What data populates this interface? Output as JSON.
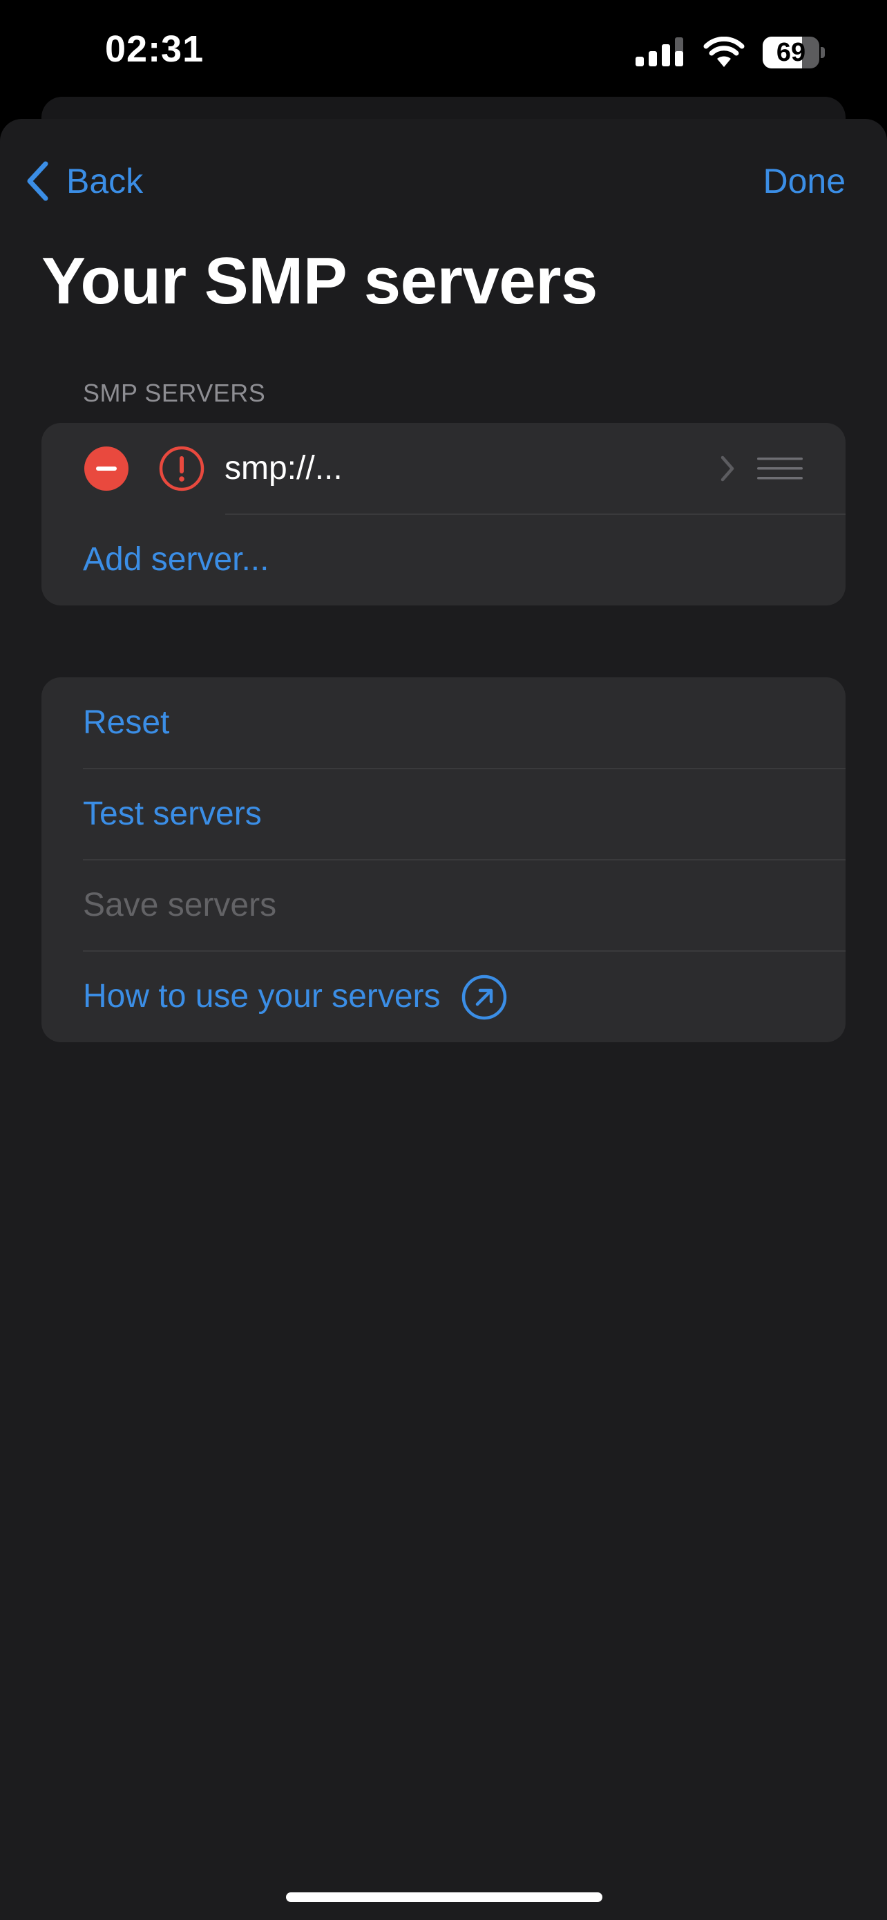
{
  "status_bar": {
    "time": "02:31",
    "battery_level": "69",
    "battery_fraction": 0.69
  },
  "nav": {
    "back_label": "Back",
    "done_label": "Done"
  },
  "page": {
    "title": "Your SMP servers"
  },
  "servers_section": {
    "header": "SMP SERVERS",
    "servers": [
      {
        "address": "smp://...",
        "status": "error"
      }
    ],
    "add_label": "Add server..."
  },
  "actions": {
    "reset_label": "Reset",
    "test_label": "Test servers",
    "save_label": "Save servers",
    "save_enabled": false,
    "howto_label": "How to use your servers"
  },
  "colors": {
    "accent": "#3b8ee6",
    "destructive": "#e9493e",
    "disabled": "#636366",
    "background": "#1c1c1e",
    "group_background": "#2c2c2e",
    "section_header": "#8e8e93"
  },
  "icons": {
    "back": "chevron-left-icon",
    "remove": "minus-circle-icon",
    "server_status": "exclamation-circle-icon",
    "disclosure": "chevron-right-icon",
    "reorder": "drag-handle-icon",
    "external": "arrow-up-right-circle-icon"
  }
}
